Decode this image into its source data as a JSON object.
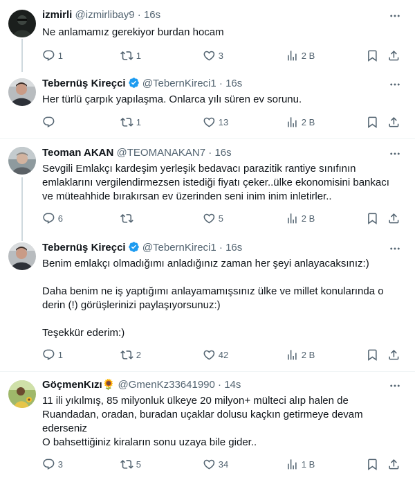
{
  "tweets": [
    {
      "name": "izmirli",
      "handle": "@izmirlibay9",
      "dot": "·",
      "time": "16s",
      "verified": false,
      "text": "Ne anlamamız gerekiyor burdan hocam",
      "replies": "1",
      "retweets": "1",
      "likes": "3",
      "views": "2 B"
    },
    {
      "name": "Tebernüş Kireçci",
      "handle": "@TebernKireci1",
      "dot": "·",
      "time": "16s",
      "verified": true,
      "text": "Her türlü çarpık yapılaşma. Onlarca yılı süren ev sorunu.",
      "replies": "",
      "retweets": "1",
      "likes": "13",
      "views": "2 B"
    },
    {
      "name": "Teoman AKAN",
      "handle": "@TEOMANAKAN7",
      "dot": "·",
      "time": "16s",
      "verified": false,
      "text": "Sevgili Emlakçı kardeşim yerleşik bedavacı parazitik rantiye sınıfının emlaklarını vergilendirmezsen istediği fiyatı çeker..ülke ekonomisini bankacı ve müteahhide bırakırsan ev üzerinden seni inim inim inletirler..",
      "replies": "6",
      "retweets": "",
      "likes": "5",
      "views": "2 B"
    },
    {
      "name": "Tebernüş Kireçci",
      "handle": "@TebernKireci1",
      "dot": "·",
      "time": "16s",
      "verified": true,
      "text": "Benim emlakçı olmadığımı anladığınız zaman her şeyi anlayacaksınız:)\n\nDaha benim ne iş yaptığımı anlayamamışsınız ülke ve millet konularında o derin (!) görüşlerinizi paylaşıyorsunuz:)\n\nTeşekkür ederim:)",
      "replies": "1",
      "retweets": "2",
      "likes": "42",
      "views": "2 B"
    },
    {
      "name": "GöçmenKızı🌻",
      "handle": "@GmenKz33641990",
      "dot": "·",
      "time": "14s",
      "verified": false,
      "text": "11 ili yıkılmış, 85 milyonluk ülkeye 20 milyon+ mülteci alıp halen de Ruandadan, oradan, buradan uçaklar dolusu kaçkın getirmeye devam ederseniz\nO bahsettiğiniz kiraların sonu uzaya bile gider..",
      "replies": "3",
      "retweets": "5",
      "likes": "34",
      "views": "1 B"
    }
  ],
  "icons": {
    "reply": "reply-icon",
    "retweet": "retweet-icon",
    "like": "heart-icon",
    "views": "views-chart-icon",
    "bookmark": "bookmark-icon",
    "share": "share-icon",
    "more": "more-dots-icon",
    "verified": "verified-badge-icon"
  },
  "colors": {
    "text": "#0f1419",
    "secondary": "#536471",
    "verified": "#1d9bf0",
    "thread_line": "#cfd9de",
    "divider": "#eff3f4"
  }
}
